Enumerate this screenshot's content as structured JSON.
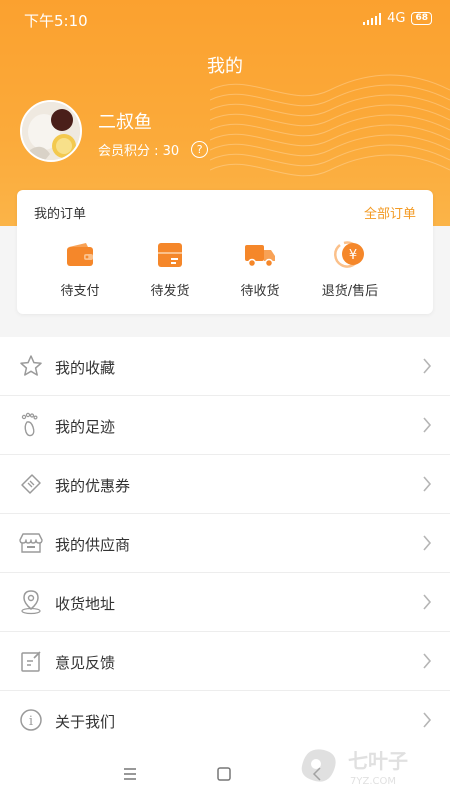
{
  "status_bar": {
    "time": "下午5:10",
    "network": "4G",
    "battery": "68"
  },
  "header": {
    "title": "我的"
  },
  "user": {
    "name": "二叔鱼",
    "points_label": "会员积分 : 30",
    "help": "?"
  },
  "orders": {
    "title": "我的订单",
    "all_link": "全部订单",
    "items": [
      {
        "label": "待支付",
        "icon": "wallet-icon"
      },
      {
        "label": "待发货",
        "icon": "package-icon"
      },
      {
        "label": "待收货",
        "icon": "truck-icon"
      },
      {
        "label": "退货/售后",
        "icon": "refund-icon",
        "glyph": "¥"
      }
    ]
  },
  "menu": [
    {
      "label": "我的收藏",
      "icon": "star-icon"
    },
    {
      "label": "我的足迹",
      "icon": "footprint-icon"
    },
    {
      "label": "我的优惠券",
      "icon": "coupon-icon"
    },
    {
      "label": "我的供应商",
      "icon": "store-icon"
    },
    {
      "label": "收货地址",
      "icon": "location-icon"
    },
    {
      "label": "意见反馈",
      "icon": "feedback-icon"
    },
    {
      "label": "关于我们",
      "icon": "info-icon",
      "glyph": "i"
    }
  ],
  "watermark": {
    "brand": "七叶子",
    "site": "7YZ.COM"
  },
  "colors": {
    "accent": "#fba12f",
    "link": "#f39a23",
    "icon_orange": "#f5872a",
    "icon_gray": "#9a9a9a"
  }
}
